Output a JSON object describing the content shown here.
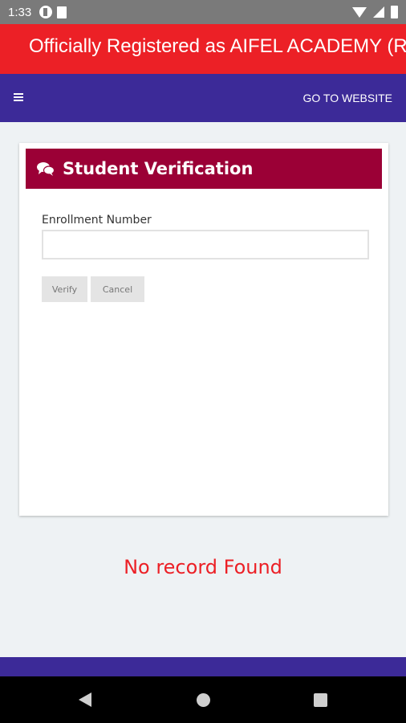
{
  "status_bar": {
    "time": "1:33",
    "icons": [
      "pocket-icon",
      "sd-card-icon",
      "wifi-icon",
      "signal-icon",
      "battery-icon"
    ]
  },
  "marquee": {
    "text": "Officially Registered as AIFEL ACADEMY (R"
  },
  "nav": {
    "menu_icon": "hamburger-menu-icon",
    "website_link": "GO TO WEBSITE"
  },
  "card": {
    "title": "Student Verification",
    "icon": "chat-bubbles-icon",
    "field_label": "Enrollment Number",
    "field_value": "",
    "verify_label": "Verify",
    "cancel_label": "Cancel"
  },
  "message": "No record Found",
  "colors": {
    "marquee_bg": "#ec2026",
    "nav_bg": "#3c2a98",
    "card_header_bg": "#9b0036",
    "message_color": "#ec2026"
  }
}
